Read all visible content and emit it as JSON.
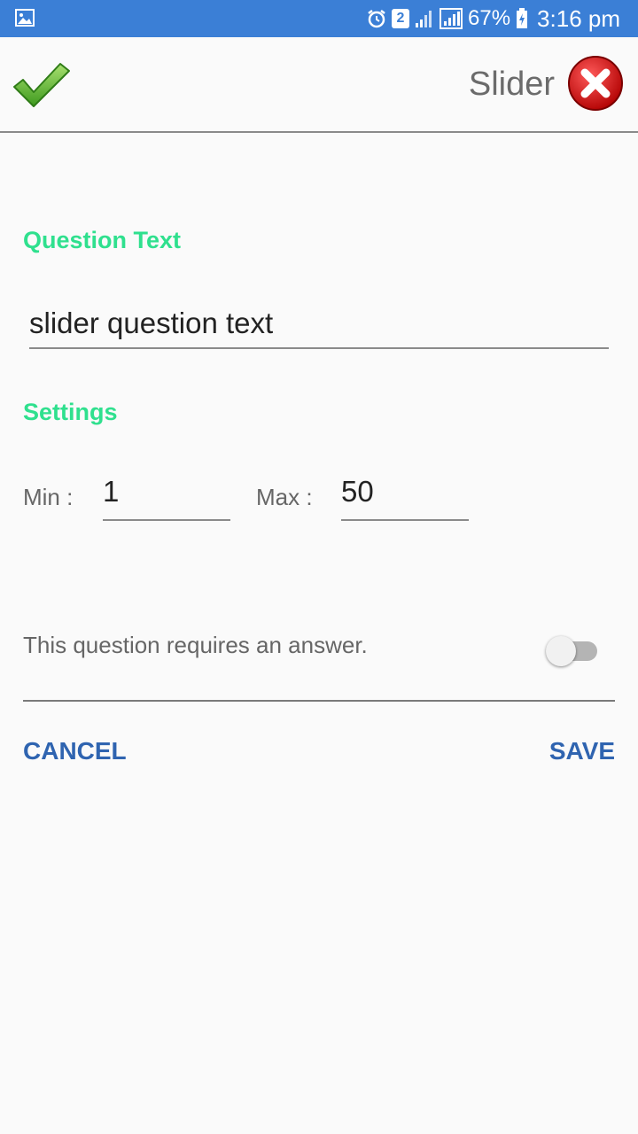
{
  "status_bar": {
    "battery": "67%",
    "time": "3:16 pm",
    "notification_count": "2",
    "color": "#3b7fd6",
    "icons": [
      "gallery-icon",
      "alarm-icon",
      "signal-icon",
      "battery-icon"
    ]
  },
  "app_bar": {
    "title": "Slider",
    "confirm_icon": "checkmark-icon",
    "close_icon": "close-icon"
  },
  "question": {
    "label": "Question Text",
    "value": "slider question text"
  },
  "settings": {
    "label": "Settings",
    "min_label": "Min :",
    "min_value": "1",
    "max_label": "Max :",
    "max_value": "50"
  },
  "required": {
    "text": "This question requires an answer.",
    "enabled": false
  },
  "actions": {
    "cancel": "CANCEL",
    "save": "SAVE"
  },
  "colors": {
    "accent_green": "#2fe08e",
    "action_blue": "#2f64b0",
    "status_bar": "#3b7fd6"
  }
}
